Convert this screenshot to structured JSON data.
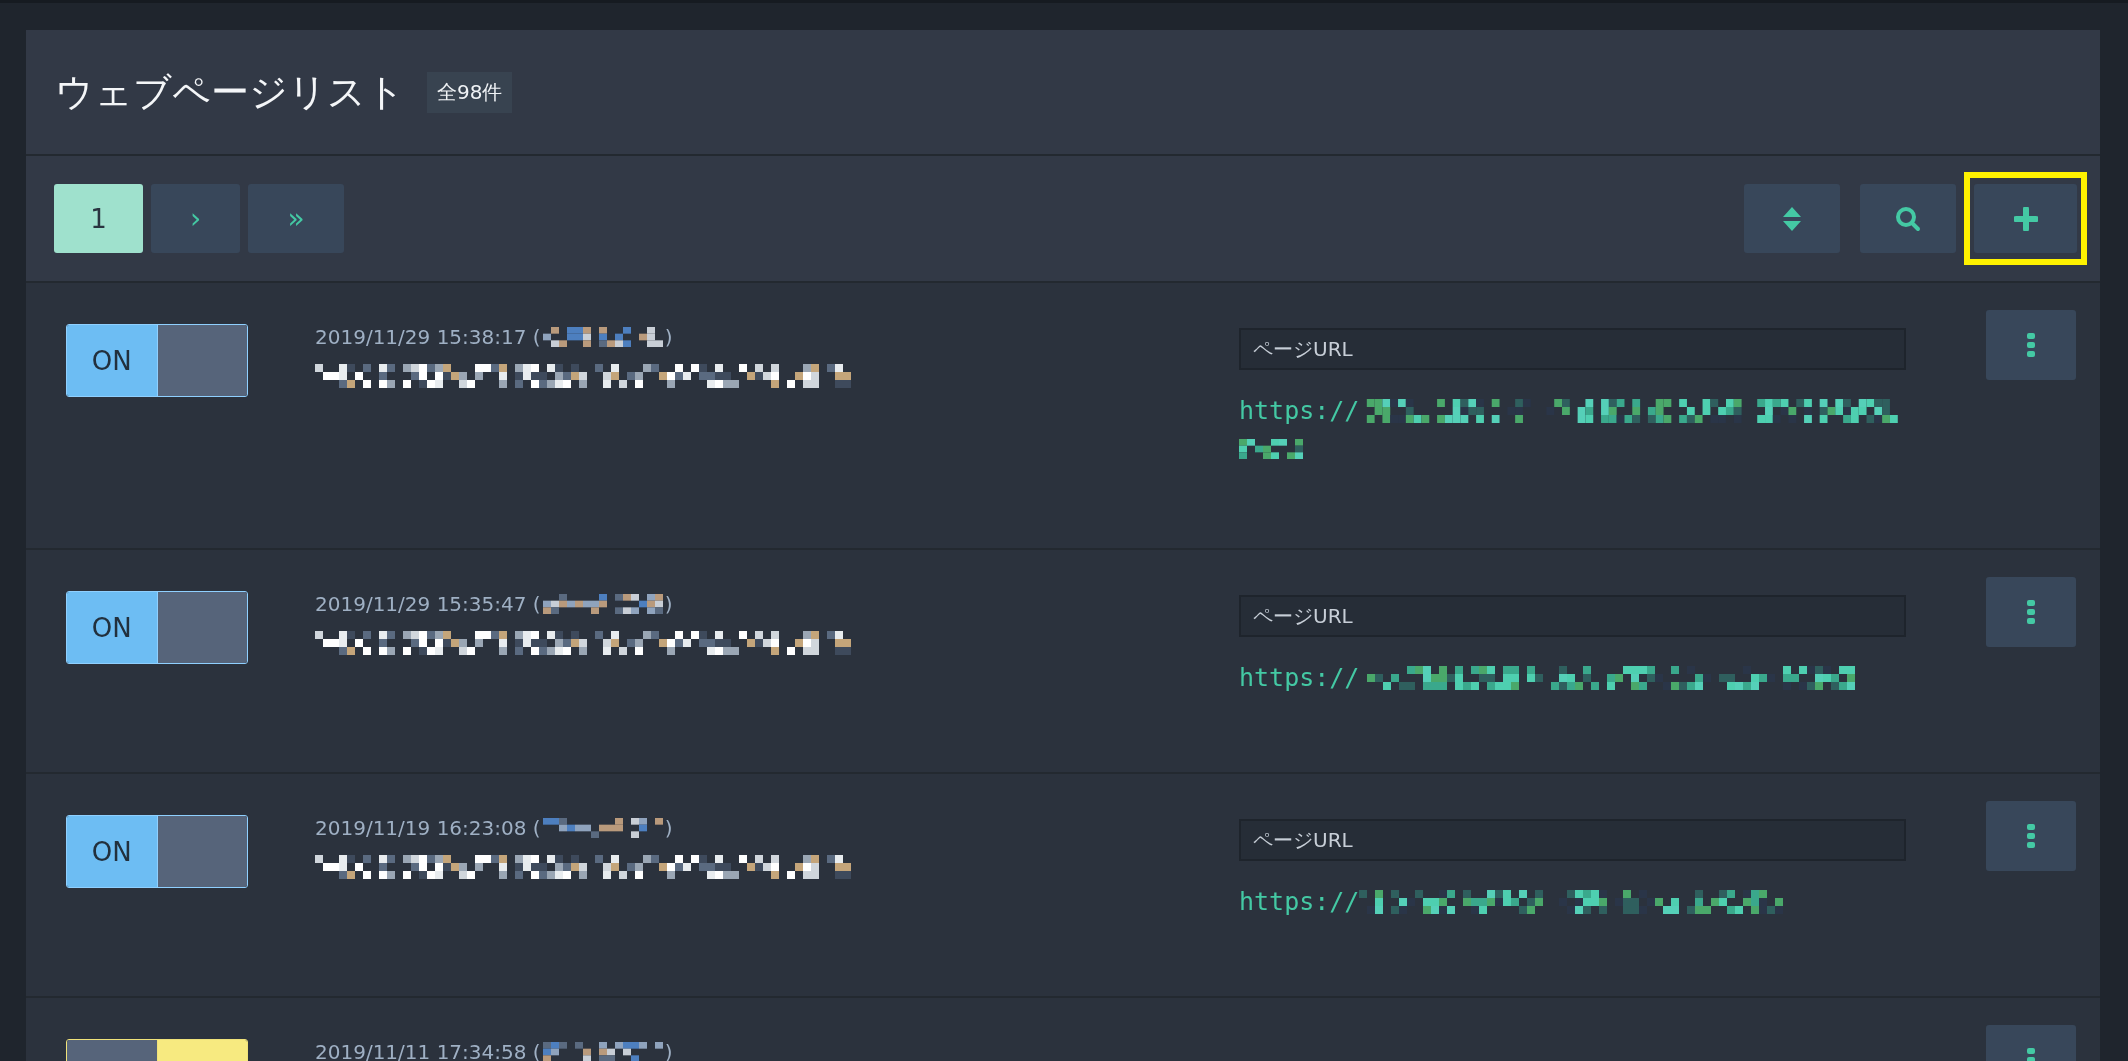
{
  "title": "ウェブページリスト",
  "count_badge": "全98件",
  "pagination": [
    {
      "label": "1",
      "selected": true
    },
    {
      "label": "›",
      "selected": false
    },
    {
      "label": "»",
      "selected": false
    }
  ],
  "toolbar": [
    {
      "kind": "sort",
      "highlighted": false
    },
    {
      "kind": "search",
      "highlighted": false
    },
    {
      "kind": "add",
      "highlighted": true
    }
  ],
  "pages": [
    {
      "on": true,
      "toggle_label": "ON",
      "date": "2019/11/29 15:38:17 (",
      "date_close": ")",
      "url_placeholder": "ページURL",
      "url_prefix": "https://",
      "url_wrapped": true
    },
    {
      "on": true,
      "toggle_label": "ON",
      "date": "2019/11/29 15:35:47 (",
      "date_close": ")",
      "url_placeholder": "ページURL",
      "url_prefix": "https://",
      "url_wrapped": false
    },
    {
      "on": true,
      "toggle_label": "ON",
      "date": "2019/11/19 16:23:08 (",
      "date_close": ")",
      "url_placeholder": "ページURL",
      "url_prefix": "https://",
      "url_wrapped": false
    },
    {
      "on": false,
      "date": "2019/11/11 17:34:58 (",
      "date_close": ")"
    }
  ]
}
